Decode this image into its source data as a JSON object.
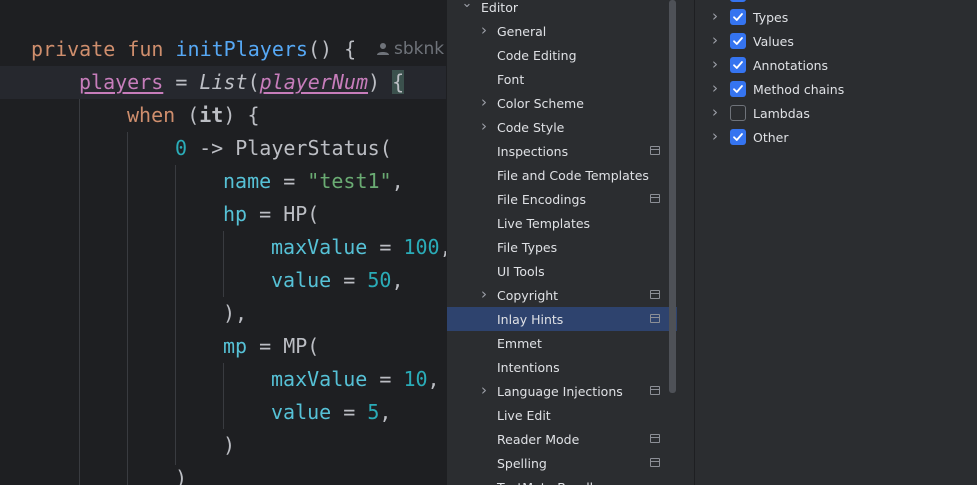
{
  "editor": {
    "author": "sbknk",
    "lines": {
      "l1": {
        "kw_private": "private",
        "kw_fun": "fun",
        "fn": "initPlayers",
        "rest": "() {"
      },
      "l2": {
        "prop": "players",
        "eq": " = ",
        "cls": "List",
        "lparen": "(",
        "param": "playerNum",
        "rparen": ")",
        "sp": " ",
        "brace": "{"
      },
      "l3": {
        "kw": "when",
        "open": " (",
        "it": "it",
        "close": ") {"
      },
      "l4": {
        "num": "0",
        "arrow": " -> PlayerStatus("
      },
      "l5": {
        "param": "name",
        "eq": " = ",
        "str": "\"test1\"",
        "comma": ","
      },
      "l6": {
        "param": "hp",
        "rest": " = HP("
      },
      "l7": {
        "param": "maxValue",
        "eq": " = ",
        "num": "100",
        "comma": ","
      },
      "l8": {
        "param": "value",
        "eq": " = ",
        "num": "50",
        "comma": ","
      },
      "l9": {
        "text": "),"
      },
      "l10": {
        "param": "mp",
        "rest": " = MP("
      },
      "l11": {
        "param": "maxValue",
        "eq": " = ",
        "num": "10",
        "comma": ","
      },
      "l12": {
        "param": "value",
        "eq": " = ",
        "num": "5",
        "comma": ","
      },
      "l13": {
        "text": ")"
      },
      "l14": {
        "text": ")"
      }
    }
  },
  "settings_tree": {
    "items": [
      {
        "label": "Editor",
        "expanded": true
      },
      {
        "label": "General",
        "expandable": true
      },
      {
        "label": "Code Editing"
      },
      {
        "label": "Font"
      },
      {
        "label": "Color Scheme",
        "expandable": true
      },
      {
        "label": "Code Style",
        "expandable": true
      },
      {
        "label": "Inspections",
        "badge": true
      },
      {
        "label": "File and Code Templates"
      },
      {
        "label": "File Encodings",
        "badge": true
      },
      {
        "label": "Live Templates"
      },
      {
        "label": "File Types"
      },
      {
        "label": "UI Tools"
      },
      {
        "label": "Copyright",
        "expandable": true,
        "badge": true
      },
      {
        "label": "Inlay Hints",
        "badge": true,
        "selected": true
      },
      {
        "label": "Emmet"
      },
      {
        "label": "Intentions"
      },
      {
        "label": "Language Injections",
        "expandable": true,
        "badge": true
      },
      {
        "label": "Live Edit"
      },
      {
        "label": "Reader Mode",
        "badge": true
      },
      {
        "label": "Spelling",
        "badge": true
      },
      {
        "label": "TextMate Bundles"
      }
    ]
  },
  "options_panel": {
    "items": [
      {
        "label": "Types",
        "checked": true
      },
      {
        "label": "Values",
        "checked": true
      },
      {
        "label": "Annotations",
        "checked": true
      },
      {
        "label": "Method chains",
        "checked": true
      },
      {
        "label": "Lambdas",
        "checked": false
      },
      {
        "label": "Other",
        "checked": true
      }
    ]
  },
  "colors": {
    "accent": "#3574f0",
    "selection": "#2e436e",
    "keyword": "#cf8e6d",
    "function": "#56a8f5",
    "property": "#c77dbb",
    "number": "#2aacb8",
    "string": "#6aab73"
  }
}
